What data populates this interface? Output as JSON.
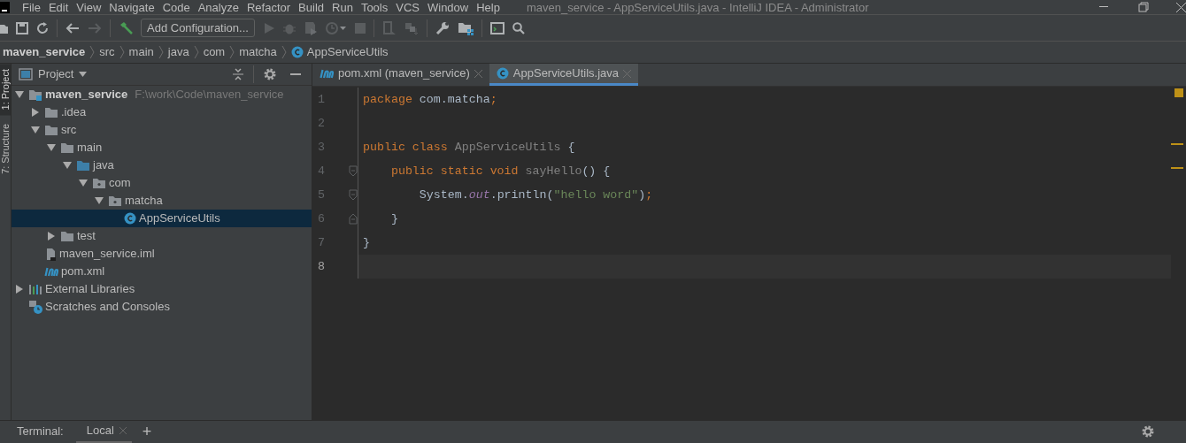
{
  "window": {
    "title": "maven_service - AppServiceUtils.java - IntelliJ IDEA - Administrator"
  },
  "menu": [
    "File",
    "Edit",
    "View",
    "Navigate",
    "Code",
    "Analyze",
    "Refactor",
    "Build",
    "Run",
    "Tools",
    "VCS",
    "Window",
    "Help"
  ],
  "toolbar": {
    "run_configuration": "Add Configuration..."
  },
  "breadcrumbs": [
    {
      "label": "maven_service",
      "kind": "project"
    },
    {
      "label": "src",
      "kind": "folder"
    },
    {
      "label": "main",
      "kind": "folder"
    },
    {
      "label": "java",
      "kind": "folder"
    },
    {
      "label": "com",
      "kind": "folder"
    },
    {
      "label": "matcha",
      "kind": "folder"
    },
    {
      "label": "AppServiceUtils",
      "kind": "class"
    }
  ],
  "tool_stripe": [
    {
      "label": "1: Project",
      "selected": true
    },
    {
      "label": "7: Structure",
      "selected": false
    }
  ],
  "project_panel": {
    "title": "Project",
    "tree": [
      {
        "label": "maven_service",
        "hint": "F:\\work\\Code\\maven_service",
        "kind": "module",
        "expanded": true,
        "selected": false,
        "children": [
          {
            "label": ".idea",
            "kind": "folder",
            "expanded": false,
            "selected": false
          },
          {
            "label": "src",
            "kind": "folder",
            "expanded": true,
            "selected": false,
            "children": [
              {
                "label": "main",
                "kind": "folder",
                "expanded": true,
                "selected": false,
                "children": [
                  {
                    "label": "java",
                    "kind": "source",
                    "expanded": true,
                    "selected": false,
                    "children": [
                      {
                        "label": "com",
                        "kind": "package",
                        "expanded": true,
                        "selected": false,
                        "children": [
                          {
                            "label": "matcha",
                            "kind": "package",
                            "expanded": true,
                            "selected": false,
                            "children": [
                              {
                                "label": "AppServiceUtils",
                                "kind": "class",
                                "selected": true
                              }
                            ]
                          }
                        ]
                      }
                    ]
                  }
                ]
              },
              {
                "label": "test",
                "kind": "folder",
                "expanded": false,
                "selected": false
              }
            ]
          },
          {
            "label": "maven_service.iml",
            "kind": "iml",
            "selected": false
          },
          {
            "label": "pom.xml",
            "kind": "maven",
            "selected": false
          }
        ]
      },
      {
        "label": "External Libraries",
        "kind": "libraries",
        "expanded": false,
        "selected": false
      },
      {
        "label": "Scratches and Consoles",
        "kind": "scratches",
        "selected": false
      }
    ]
  },
  "editor": {
    "tabs": [
      {
        "label": "pom.xml (maven_service)",
        "kind": "maven",
        "selected": false
      },
      {
        "label": "AppServiceUtils.java",
        "kind": "class",
        "selected": true
      }
    ],
    "lines": [
      {
        "number": "1",
        "current": false,
        "kind": "plain",
        "tokens": [
          {
            "text": "package",
            "kind": "keyword"
          },
          {
            "text": " com.matcha",
            "kind": "plain"
          },
          {
            "text": ";",
            "kind": "keyword"
          }
        ]
      },
      {
        "number": "2",
        "current": false,
        "kind": "plain"
      },
      {
        "number": "3",
        "current": false,
        "kind": "plain",
        "tokens": [
          {
            "text": "public class",
            "kind": "keyword"
          },
          {
            "text": " AppServiceUtils",
            "kind": "unused"
          },
          {
            "text": " {",
            "kind": "plain"
          }
        ]
      },
      {
        "number": "4",
        "current": false,
        "kind": "fold_start",
        "tokens": [
          {
            "text": "    public static void",
            "kind": "keyword"
          },
          {
            "text": " sayHello",
            "kind": "unused"
          },
          {
            "text": "() {",
            "kind": "plain"
          }
        ]
      },
      {
        "number": "5",
        "current": false,
        "kind": "fold_start",
        "tokens": [
          {
            "text": "        System.",
            "kind": "plain"
          },
          {
            "text": "out",
            "kind": "static"
          },
          {
            "text": ".println(",
            "kind": "plain"
          },
          {
            "text": "\"hello word\"",
            "kind": "string"
          },
          {
            "text": ")",
            "kind": "plain"
          },
          {
            "text": ";",
            "kind": "keyword"
          }
        ]
      },
      {
        "number": "6",
        "current": false,
        "kind": "fold_end",
        "tokens": [
          {
            "text": "    }",
            "kind": "plain"
          }
        ]
      },
      {
        "number": "7",
        "current": false,
        "kind": "plain",
        "tokens": [
          {
            "text": "}",
            "kind": "plain"
          }
        ]
      },
      {
        "number": "8",
        "current": true,
        "kind": "plain"
      }
    ]
  },
  "terminal": {
    "title": "Terminal:",
    "tabs": [
      {
        "label": "Local",
        "selected": true
      }
    ],
    "add": "+"
  }
}
